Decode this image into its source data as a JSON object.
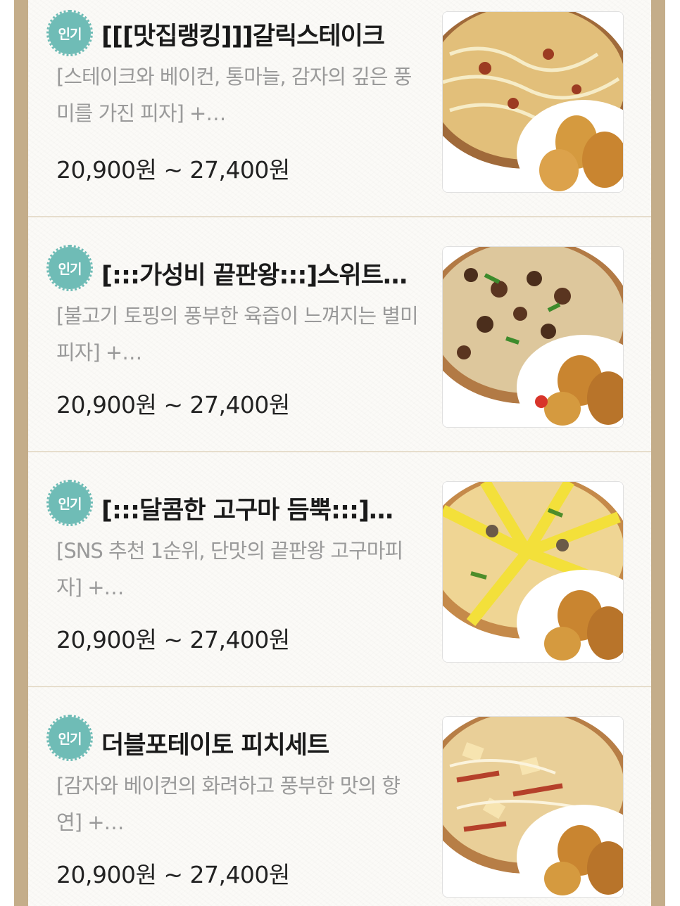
{
  "menu": {
    "items": [
      {
        "badge": "인기",
        "title": "[[[맛집랭킹]]]갈릭스테이크",
        "description": "[스테이크와 베이컨, 통마늘, 감자의 깊은 풍미를 가진 피자] +…",
        "price": "20,900원 ~ 27,400원",
        "image_icon": "pizza-chicken-image"
      },
      {
        "badge": "인기",
        "title": "[:::가성비 끝판왕:::]스위트불고기",
        "description": "[불고기 토핑의 풍부한 육즙이 느껴지는 별미 피자] +…",
        "price": "20,900원 ~ 27,400원",
        "image_icon": "pizza-chicken-image"
      },
      {
        "badge": "인기",
        "title": "[:::달콤한 고구마 듬뿍:::]…",
        "description": "[SNS 추천 1순위, 단맛의 끝판왕 고구마피자] +…",
        "price": "20,900원 ~ 27,400원",
        "image_icon": "pizza-chicken-image"
      },
      {
        "badge": "인기",
        "title": "더블포테이토 피치세트",
        "description": "[감자와 베이컨의 화려하고 풍부한 맛의 향연] +…",
        "price": "20,900원 ~ 27,400원",
        "image_icon": "pizza-chicken-image"
      }
    ]
  },
  "colors": {
    "badge": "#6fbcb6",
    "frame": "#c4ad8a",
    "divider": "#e6ddcc",
    "description": "#9a9a9a"
  }
}
